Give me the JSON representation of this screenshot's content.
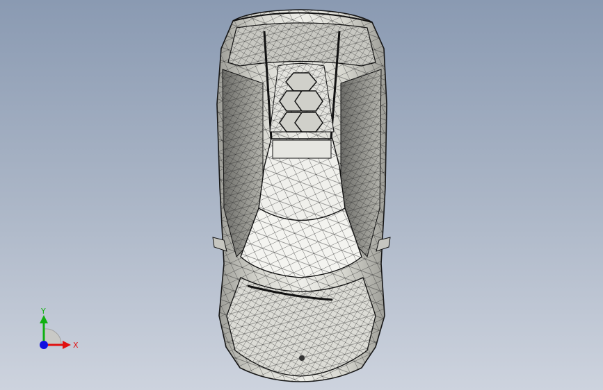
{
  "view": {
    "orientation": "top view",
    "display_style": "wireframe with shaded faces"
  },
  "triad": {
    "x_label": "X",
    "y_label": "Y",
    "x_color": "#e01010",
    "y_color": "#10b010",
    "z_color": "#1010e0"
  },
  "colors": {
    "background_top": "#8a9ab2",
    "background_bottom": "#cdd3de",
    "surface": "#d8d8d2",
    "surface_highlight": "#f2f2ee",
    "edges": "#1a1a1a"
  }
}
